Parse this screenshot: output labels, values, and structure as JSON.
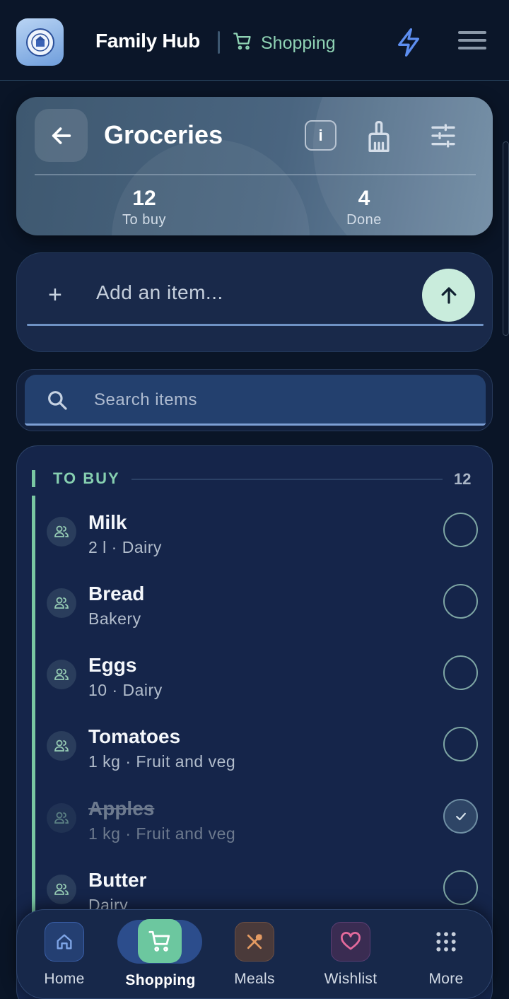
{
  "header": {
    "app_title": "Family Hub",
    "section_label": "Shopping",
    "icons": {
      "logo": "family-logo",
      "cart": "cart-icon",
      "bolt": "bolt-icon",
      "menu": "hamburger-menu-icon"
    }
  },
  "list": {
    "name": "Groceries",
    "stats": [
      {
        "value": "12",
        "label": "To buy"
      },
      {
        "value": "4",
        "label": "Done"
      }
    ]
  },
  "add_item": {
    "placeholder": "Add an item..."
  },
  "search": {
    "placeholder": "Search items"
  },
  "section": {
    "title": "TO BUY",
    "count": "12"
  },
  "items": [
    {
      "name": "Milk",
      "meta": "2 l  ·  Dairy",
      "done": false
    },
    {
      "name": "Bread",
      "meta": "Bakery",
      "done": false
    },
    {
      "name": "Eggs",
      "meta": "10  ·  Dairy",
      "done": false
    },
    {
      "name": "Tomatoes",
      "meta": "1 kg  ·  Fruit and veg",
      "done": false
    },
    {
      "name": "Apples",
      "meta": "1 kg  ·  Fruit and veg",
      "done": true
    },
    {
      "name": "Butter",
      "meta": "Dairy",
      "done": false
    }
  ],
  "nav": [
    {
      "label": "Home",
      "icon": "home-icon",
      "color": "#7fa6e8"
    },
    {
      "label": "Shopping",
      "icon": "cart-icon",
      "color": "#ffffff"
    },
    {
      "label": "Meals",
      "icon": "utensils-icon",
      "color": "#e39a62"
    },
    {
      "label": "Wishlist",
      "icon": "heart-icon",
      "color": "#e46a9c"
    },
    {
      "label": "More",
      "icon": "grid-icon",
      "color": "#c7cfdb"
    }
  ],
  "colors": {
    "accent": "#79c7a2",
    "background": "#0a1527",
    "card": "#15254a"
  }
}
